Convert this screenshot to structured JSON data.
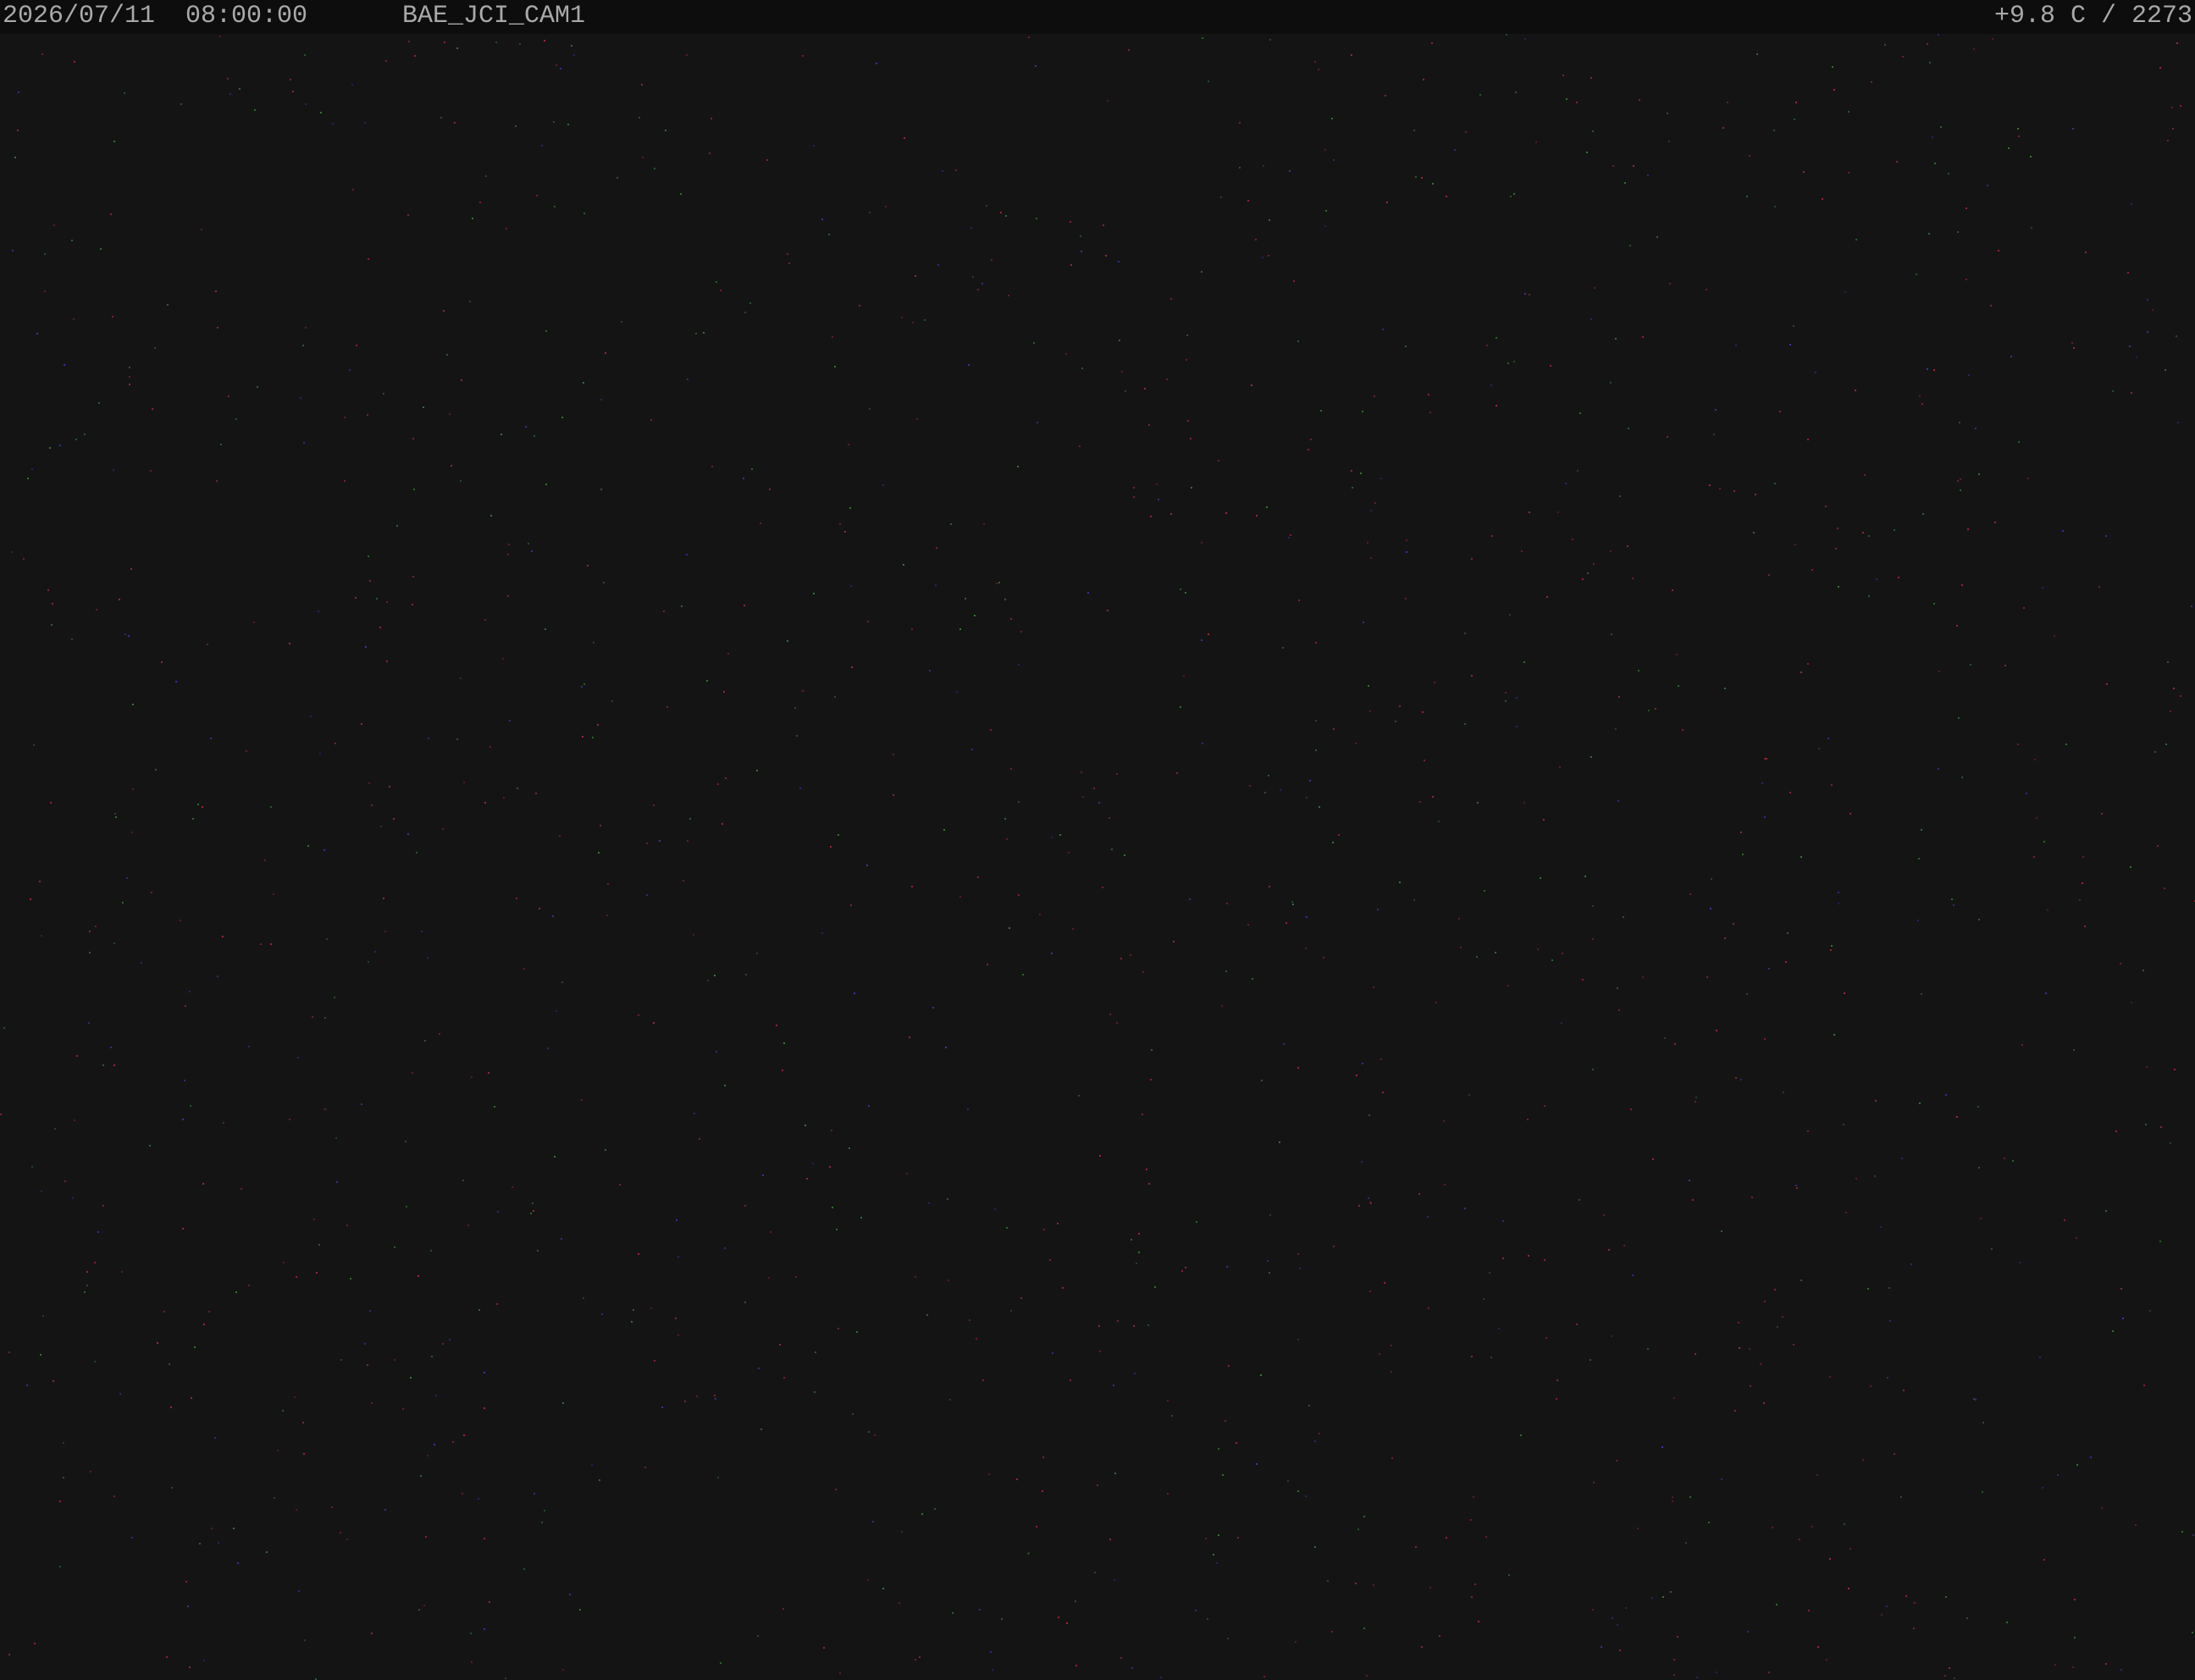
{
  "osd": {
    "datetime": "2026/07/11  08:00:00",
    "camera_name": "BAE_JCI_CAM1",
    "sensor_readout": "+9.8 C / 2273"
  },
  "colors": {
    "background": "#141414",
    "osd_bar": "#0d0d0d",
    "osd_text": "#a9a9a9",
    "noise_red": "#c0283c",
    "noise_blue": "#3c3cc8",
    "noise_green": "#3c8c3c"
  }
}
